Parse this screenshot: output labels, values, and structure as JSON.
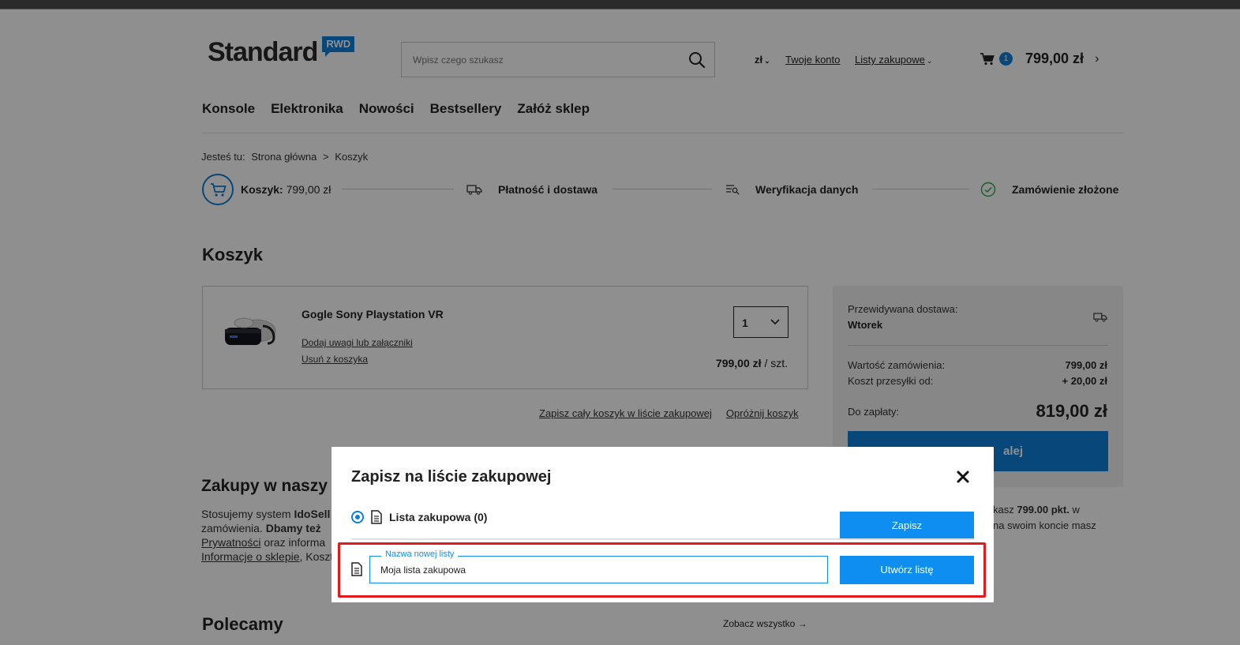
{
  "header": {
    "logo_text": "Standard",
    "logo_badge": "RWD",
    "search_placeholder": "Wpisz czego szukasz",
    "currency": "zł",
    "account": "Twoje konto",
    "lists": "Listy zakupowe",
    "cart_count": "1",
    "cart_total": "799,00 zł"
  },
  "menu": [
    "Konsole",
    "Elektronika",
    "Nowości",
    "Bestsellery",
    "Załóż sklep"
  ],
  "breadcrumb": {
    "prefix": "Jesteś tu:",
    "home": "Strona główna",
    "sep": ">",
    "current": "Koszyk"
  },
  "steps": {
    "cart_label": "Koszyk:",
    "cart_value": "799,00 zł",
    "payment": "Płatność i dostawa",
    "verify": "Weryfikacja danych",
    "done": "Zamówienie złożone"
  },
  "cart": {
    "heading": "Koszyk",
    "item_name": "Gogle Sony Playstation VR",
    "add_notes": "Dodaj uwagi lub załączniki",
    "remove": "Usuń z koszyka",
    "qty": "1",
    "price": "799,00 zł",
    "price_unit": "/ szt.",
    "save_all": "Zapisz cały koszyk w liście zakupowej",
    "empty": "Opróżnij koszyk"
  },
  "summary": {
    "delivery_label": "Przewidywana dostawa:",
    "delivery_day": "Wtorek",
    "order_value_label": "Wartość zamówienia:",
    "order_value": "799,00 zł",
    "shipping_label": "Koszt przesyłki od:",
    "shipping_value": "+ 20,00 zł",
    "to_pay_label": "Do zapłaty:",
    "to_pay": "819,00 zł",
    "next_button": "alej"
  },
  "info": {
    "heading": "Zakupy w naszy",
    "line1_a": "Stosujemy system ",
    "line1_b": "IdoSell",
    "line2_a": "zamówienia. ",
    "line2_b": "Dbamy też",
    "line3_a": "Prywatności",
    "line3_b": " oraz informa",
    "line4_a": "Informacje o sklepie",
    "line4_b": ", Koszt",
    "right_a": "kasz ",
    "right_b": "799.00 pkt.",
    "right_c": " w",
    "right_d": "na swoim koncie masz"
  },
  "recommended": {
    "heading": "Polecamy",
    "see_all": "Zobacz wszystko"
  },
  "modal": {
    "title": "Zapisz na liście zakupowej",
    "list_label": "Lista zakupowa (0)",
    "save_button": "Zapisz",
    "new_list_legend": "Nazwa nowej listy",
    "new_list_value": "Moja lista zakupowa",
    "create_button": "Utwórz listę"
  },
  "colors": {
    "accent": "#0e8ef0",
    "highlight": "#e21a1a"
  }
}
